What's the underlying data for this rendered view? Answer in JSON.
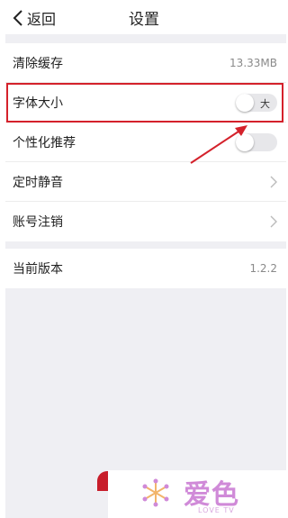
{
  "nav": {
    "back_label": "返回",
    "title": "设置"
  },
  "settings": {
    "clear_cache": {
      "label": "清除缓存",
      "value": "13.33MB"
    },
    "font_size": {
      "label": "字体大小",
      "toggle_text": "大",
      "enabled": false
    },
    "personalized": {
      "label": "个性化推荐",
      "enabled": false
    },
    "timed_mute": {
      "label": "定时静音"
    },
    "account_cancel": {
      "label": "账号注销"
    }
  },
  "version": {
    "label": "当前版本",
    "value": "1.2.2"
  },
  "watermark": {
    "brand": "爱色",
    "sub": "LOVE TV"
  },
  "colors": {
    "accent": "#d4212b",
    "page_bg": "#efeff3",
    "brand": "#d08ad8"
  }
}
